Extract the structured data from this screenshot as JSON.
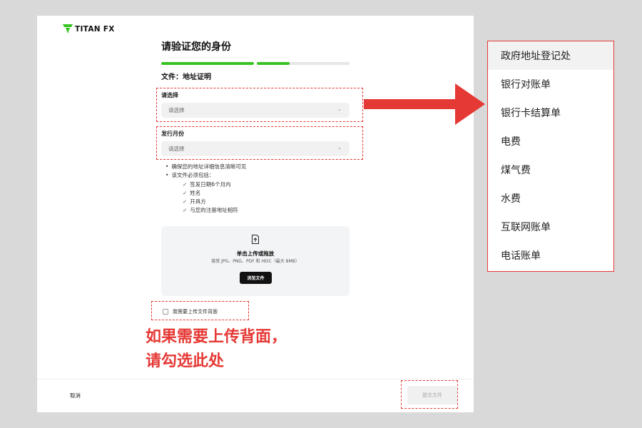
{
  "app": {
    "logo_text": "TITAN FX"
  },
  "form": {
    "title": "请验证您的身份",
    "progress_fractions": [
      1.0,
      0.35
    ],
    "document_label": "文件：地址证明",
    "field1": {
      "label": "请选择",
      "placeholder": "请选择"
    },
    "field2": {
      "label": "发行月份",
      "placeholder": "请选择"
    },
    "bullets": [
      "确保您的地址详细信息清晰可见",
      "该文件必须包括："
    ],
    "requirements": [
      "签发日期6个月内",
      "姓名",
      "开具方",
      "与您的注册地址相符"
    ],
    "upload": {
      "title": "单击上传或拖放",
      "subtitle": "接受 JPG、PNG、PDF 和 HEIC（最大 8MB）",
      "browse_label": "浏览文件"
    },
    "checkbox_label": "我需要上传文件背面",
    "cancel_label": "取消",
    "submit_label": "提交文件"
  },
  "annotation": {
    "line1": "如果需要上传背面，",
    "line2": "请勾选此处"
  },
  "dropdown": {
    "items": [
      "政府地址登记处",
      "银行对账单",
      "银行卡结算单",
      "电费",
      "煤气费",
      "水费",
      "互联网账单",
      "电话账单"
    ],
    "highlighted_index": 0
  },
  "colors": {
    "accent_green": "#37c322",
    "annotation_red": "#e53935"
  }
}
